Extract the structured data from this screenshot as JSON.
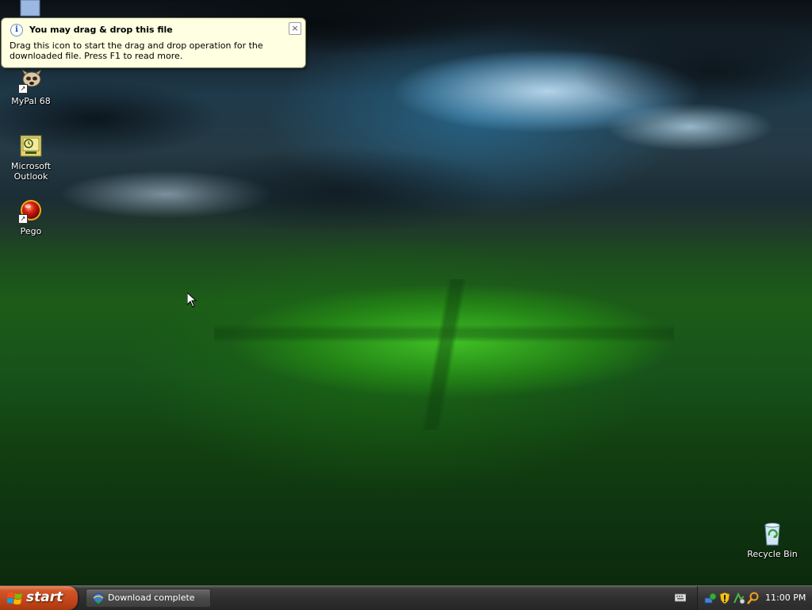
{
  "desktop": {
    "icons": [
      {
        "label": "MyPal 68",
        "icon": "mypal-icon"
      },
      {
        "label": "Microsoft Outlook",
        "icon": "outlook-icon"
      },
      {
        "label": "Pego",
        "icon": "pego-icon"
      },
      {
        "label": "Recycle Bin",
        "icon": "recycle-bin-icon"
      }
    ]
  },
  "balloon": {
    "title": "You may drag & drop this file",
    "body": "Drag this icon to start the drag and drop operation for the downloaded file. Press F1 to read more.",
    "close_label": "×"
  },
  "taskbar": {
    "start_label": "start",
    "tasks": [
      {
        "label": "Download complete",
        "icon": "download-icon"
      }
    ],
    "tray": {
      "icons": [
        "network-icon",
        "security-shield-icon",
        "connection-icon",
        "search-icon"
      ],
      "clock": "11:00 PM"
    }
  },
  "colors": {
    "balloon_bg": "#ffffe1",
    "start_orange": "#c3461b",
    "taskbar": "#2f2f2f"
  }
}
